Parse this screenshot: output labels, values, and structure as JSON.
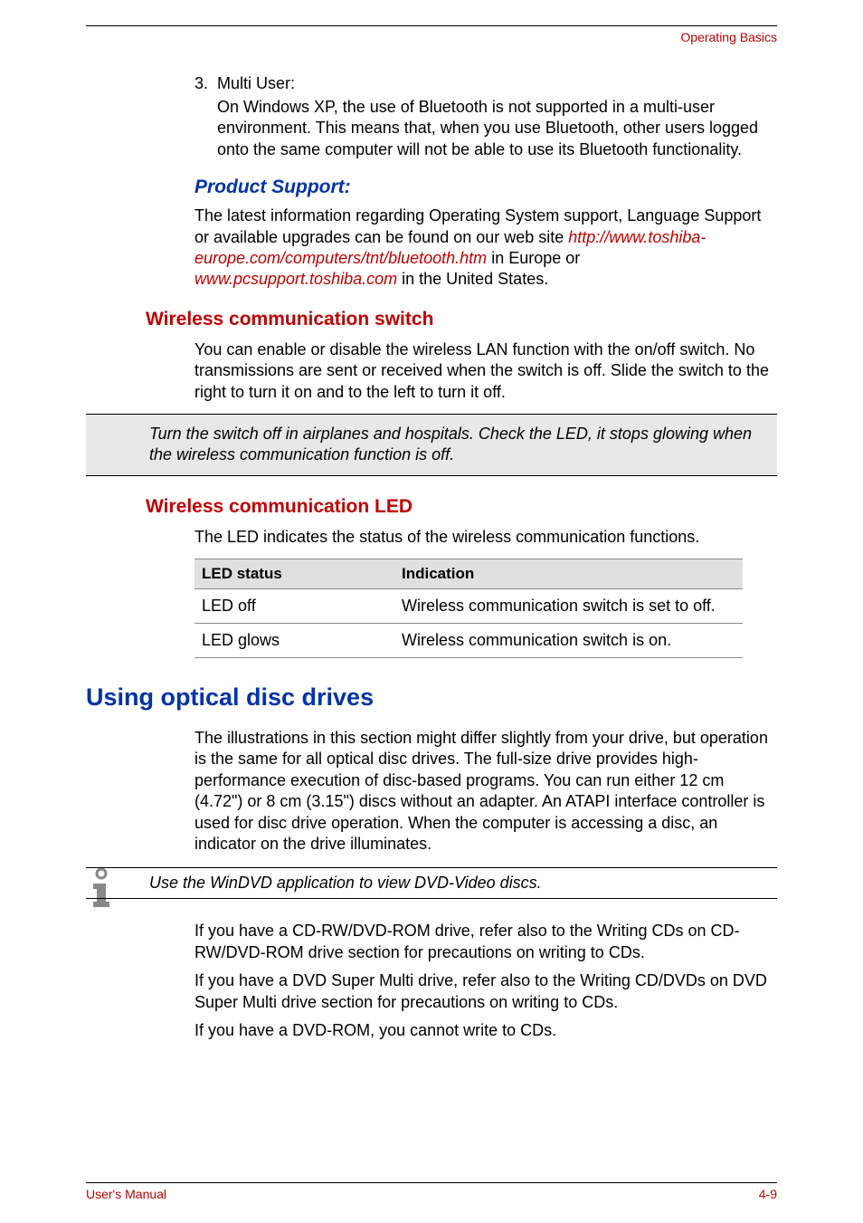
{
  "header": {
    "section_title": "Operating Basics"
  },
  "item3": {
    "num": "3.",
    "label": "Multi User:",
    "body": "On Windows XP, the use of Bluetooth is not supported in a multi-user environment. This means that, when you use Bluetooth, other users logged onto the same computer will not be able to use its Bluetooth functionality."
  },
  "product_support": {
    "heading": "Product Support:",
    "intro": "The latest information regarding Operating System support, Language Support or available upgrades can be found on our web site ",
    "link1": "http://www.toshiba-europe.com/computers/tnt/bluetooth.htm",
    "mid1": " in Europe or ",
    "link2": "www.pcsupport.toshiba.com",
    "tail": " in the United States."
  },
  "wcs": {
    "heading": "Wireless communication switch",
    "body": "You can enable or disable the wireless LAN function with the on/off switch. No transmissions are sent or received when the switch is off. Slide the switch to the right to turn it on and to the left to turn it off."
  },
  "warning": {
    "text": "Turn the switch off in airplanes and hospitals. Check the LED, it stops glowing when the wireless communication function is off."
  },
  "wcl": {
    "heading": "Wireless communication LED",
    "body": "The LED indicates the status of the wireless communication functions."
  },
  "table": {
    "col1_header": "LED status",
    "col2_header": "Indication",
    "rows": [
      {
        "c1": "LED off",
        "c2": "Wireless communication switch is set to off."
      },
      {
        "c1": "LED glows",
        "c2": "Wireless communication switch is on."
      }
    ]
  },
  "optical": {
    "heading": "Using optical disc drives",
    "body": "The illustrations in this section might differ slightly from your drive, but operation is the same for all optical disc drives. The full-size drive provides high-performance execution of disc-based programs. You can run either 12 cm (4.72\") or 8 cm (3.15\") discs without an adapter. An ATAPI interface controller is used for disc drive operation. When the computer is accessing a disc, an indicator on the drive illuminates."
  },
  "note": {
    "text": "Use the WinDVD application to view DVD-Video discs."
  },
  "after": {
    "p1": "If you have a CD-RW/DVD-ROM drive, refer also to the Writing CDs on CD-RW/DVD-ROM drive section for precautions on writing to CDs.",
    "p2": "If you have a DVD Super Multi drive, refer also to the Writing CD/DVDs on DVD Super Multi drive section for precautions on writing to CDs.",
    "p3": "If you have a DVD-ROM, you cannot write to CDs."
  },
  "footer": {
    "left": "User's Manual",
    "right": "4-9"
  }
}
